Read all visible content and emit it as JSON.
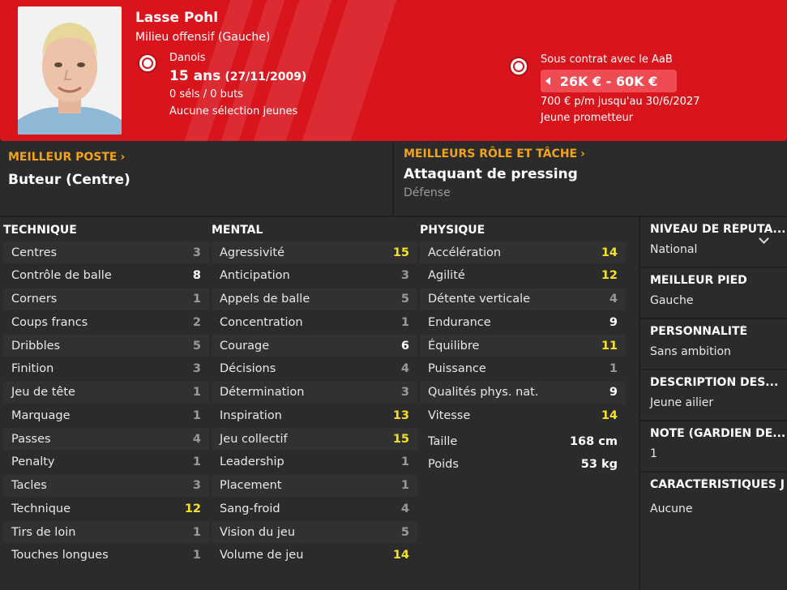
{
  "header": {
    "name": "Lasse Pohl",
    "position": "Milieu offensif (Gauche)",
    "nationality": "Danois",
    "age": "15 ans",
    "dob": "(27/11/2009)",
    "caps": "0 séls / 0 buts",
    "youth": "Aucune sélection jeunes",
    "contract_label": "Sous contrat avec le AaB",
    "value": "26K € - 60K €",
    "wage": "700 € p/m jusqu'au 30/6/2027",
    "prospect": "Jeune prometteur",
    "accent_color": "#d8141c"
  },
  "best_position": {
    "title": "MEILLEUR POSTE",
    "value": "Buteur (Centre)"
  },
  "best_role": {
    "title": "MEILLEURS RÔLE ET TÂCHE",
    "value": "Attaquant de pressing",
    "sub": "Défense"
  },
  "technique": {
    "title": "TECHNIQUE",
    "rows": [
      {
        "label": "Centres",
        "value": "3"
      },
      {
        "label": "Contrôle de balle",
        "value": "8"
      },
      {
        "label": "Corners",
        "value": "1"
      },
      {
        "label": "Coups francs",
        "value": "2"
      },
      {
        "label": "Dribbles",
        "value": "5"
      },
      {
        "label": "Finition",
        "value": "3"
      },
      {
        "label": "Jeu de tête",
        "value": "1"
      },
      {
        "label": "Marquage",
        "value": "1"
      },
      {
        "label": "Passes",
        "value": "4"
      },
      {
        "label": "Penalty",
        "value": "1"
      },
      {
        "label": "Tacles",
        "value": "3"
      },
      {
        "label": "Technique",
        "value": "12"
      },
      {
        "label": "Tirs de loin",
        "value": "1"
      },
      {
        "label": "Touches longues",
        "value": "1"
      }
    ]
  },
  "mental": {
    "title": "MENTAL",
    "rows": [
      {
        "label": "Agressivité",
        "value": "15"
      },
      {
        "label": "Anticipation",
        "value": "3"
      },
      {
        "label": "Appels de balle",
        "value": "5"
      },
      {
        "label": "Concentration",
        "value": "1"
      },
      {
        "label": "Courage",
        "value": "6"
      },
      {
        "label": "Décisions",
        "value": "4"
      },
      {
        "label": "Détermination",
        "value": "3"
      },
      {
        "label": "Inspiration",
        "value": "13"
      },
      {
        "label": "Jeu collectif",
        "value": "15"
      },
      {
        "label": "Leadership",
        "value": "1"
      },
      {
        "label": "Placement",
        "value": "1"
      },
      {
        "label": "Sang-froid",
        "value": "4"
      },
      {
        "label": "Vision du jeu",
        "value": "5"
      },
      {
        "label": "Volume de jeu",
        "value": "14"
      }
    ]
  },
  "physique": {
    "title": "PHYSIQUE",
    "rows": [
      {
        "label": "Accélération",
        "value": "14"
      },
      {
        "label": "Agilité",
        "value": "12"
      },
      {
        "label": "Détente verticale",
        "value": "4"
      },
      {
        "label": "Endurance",
        "value": "9"
      },
      {
        "label": "Équilibre",
        "value": "11"
      },
      {
        "label": "Puissance",
        "value": "1"
      },
      {
        "label": "Qualités phys. nat.",
        "value": "9"
      },
      {
        "label": "Vitesse",
        "value": "14"
      }
    ],
    "height_label": "Taille",
    "height": "168 cm",
    "weight_label": "Poids",
    "weight": "53 kg"
  },
  "side": {
    "reputation_title": "NIVEAU DE RÉPUTA...",
    "reputation": "National",
    "foot_title": "MEILLEUR PIED",
    "foot": "Gauche",
    "personality_title": "PERSONNALITÉ",
    "personality": "Sans ambition",
    "media_title": "DESCRIPTION DES...",
    "media": "Jeune ailier",
    "gk_title": "NOTE (GARDIEN DE...",
    "gk": "1",
    "traits_title": "CARACTÉRISTIQUES J",
    "traits": "Aucune"
  }
}
